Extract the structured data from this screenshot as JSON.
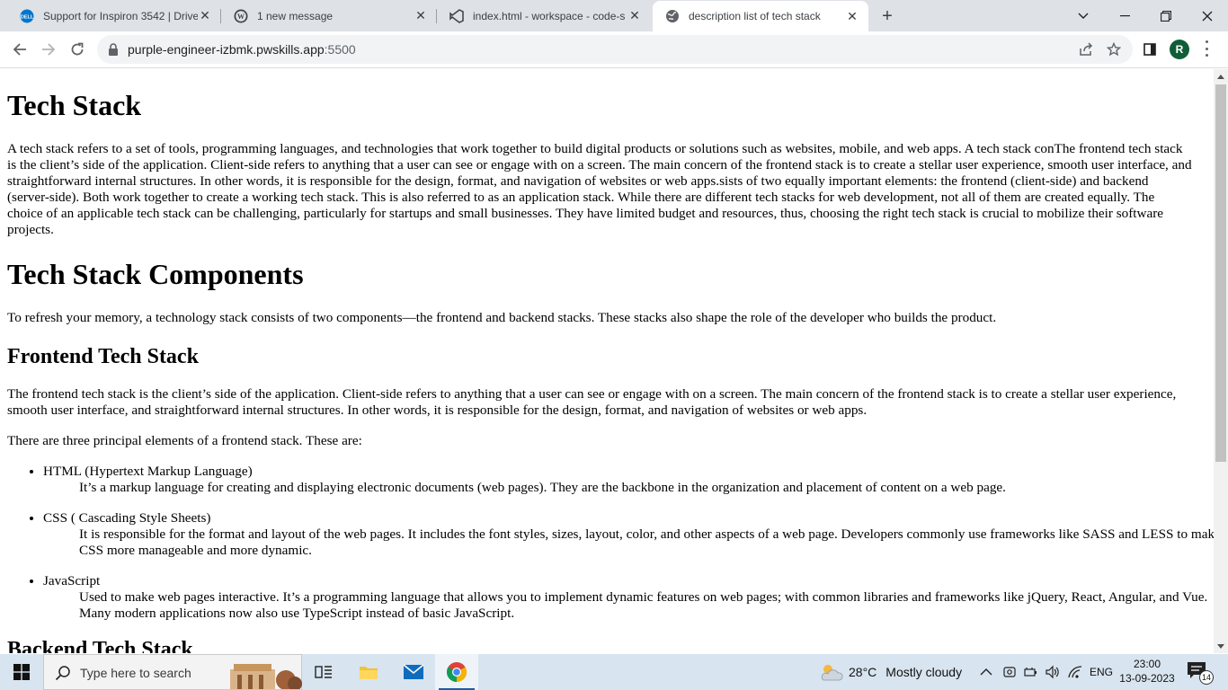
{
  "browser": {
    "tabs": [
      {
        "title": "Support for Inspiron 3542 | Drive",
        "icon": "dell-icon"
      },
      {
        "title": "1 new message",
        "icon": "wordpress-icon"
      },
      {
        "title": "index.html - workspace - code-s",
        "icon": "vscode-icon"
      },
      {
        "title": "description list of tech stack",
        "icon": "globe-icon",
        "active": true
      }
    ],
    "new_tab_label": "+",
    "url_host": "purple-engineer-izbmk.pwskills.app",
    "url_port": ":5500",
    "profile_initial": "R"
  },
  "page": {
    "h1_tech_stack": "Tech Stack",
    "intro": "A tech stack refers to a set of tools, programming languages, and technologies that work together to build digital products or solutions such as websites, mobile, and web apps. A tech stack conThe frontend tech stack is the client’s side of the application. Client-side refers to anything that a user can see or engage with on a screen. The main concern of the frontend stack is to create a stellar user experience, smooth user interface, and straightforward internal structures. In other words, it is responsible for the design, format, and navigation of websites or web apps.sists of two equally important elements: the frontend (client-side) and backend (server-side). Both work together to create a working tech stack. This is also referred to as an application stack. While there are different tech stacks for web development, not all of them are created equally. The choice of an applicable tech stack can be challenging, particularly for startups and small businesses. They have limited budget and resources, thus, choosing the right tech stack is crucial to mobilize their software projects.",
    "h1_components": "Tech Stack Components",
    "components_text": "To refresh your memory, a technology stack consists of two components—the frontend and backend stacks. These stacks also shape the role of the developer who builds the product.",
    "h3_frontend": "Frontend Tech Stack",
    "frontend_text": "The frontend tech stack is the client’s side of the application. Client-side refers to anything that a user can see or engage with on a screen. The main concern of the frontend stack is to create a stellar user experience, smooth user interface, and straightforward internal structures. In other words, it is responsible for the design, format, and navigation of websites or web apps.",
    "principal_text": "There are three principal elements of a frontend stack. These are:",
    "elements": [
      {
        "term": "HTML (Hypertext Markup Language)",
        "desc": "It’s a markup language for creating and displaying electronic documents (web pages). They are the backbone in the organization and placement of content on a web page."
      },
      {
        "term": "CSS ( Cascading Style Sheets)",
        "desc": "It is responsible for the format and layout of the web pages. It includes the font styles, sizes, layout, color, and other aspects of a web page. Developers commonly use frameworks like SASS and LESS to make CSS more manageable and more dynamic."
      },
      {
        "term": "JavaScript",
        "desc": "Used to make web pages interactive. It’s a programming language that allows you to implement dynamic features on web pages; with common libraries and frameworks like jQuery, React, Angular, and Vue. Many modern applications now also use TypeScript instead of basic JavaScript."
      }
    ],
    "h3_backend": "Backend Tech Stack"
  },
  "taskbar": {
    "search_placeholder": "Type here to search",
    "weather_temp": "28°C",
    "weather_text": "Mostly cloudy",
    "language": "ENG",
    "time": "23:00",
    "date": "13-09-2023",
    "notification_count": "14"
  },
  "colors": {
    "tabstrip_bg": "#dee1e6",
    "taskbar_bg": "#d8e4ef",
    "profile_bg": "#0f5e37"
  }
}
